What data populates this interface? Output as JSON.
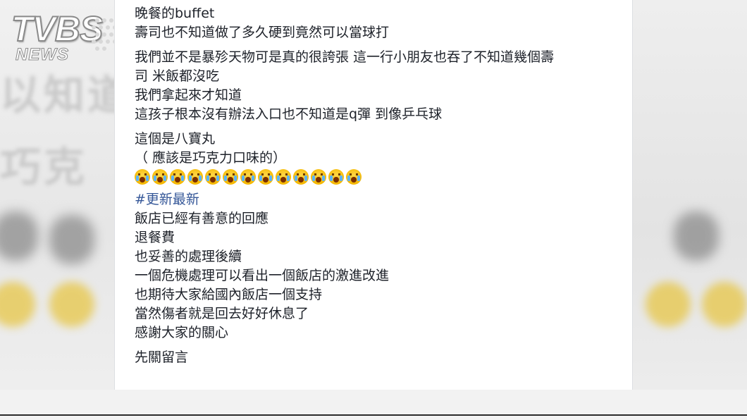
{
  "logo": {
    "main": "TVBS",
    "sub": "NEWS"
  },
  "post": {
    "paragraphs": [
      {
        "lines": [
          "晚餐的buffet",
          "壽司也不知道做了多久硬到竟然可以當球打"
        ]
      },
      {
        "lines": [
          "我們並不是暴殄天物可是真的很誇張 這一行小朋友也吞了不知道幾個壽",
          "司 米飯都沒吃",
          "我們拿起來才知道",
          "這孩子根本沒有辦法入口也不知道是q彈 到像乒乓球"
        ]
      },
      {
        "lines": [
          "這個是八寶丸",
          "（ 應該是巧克力口味的）"
        ]
      }
    ],
    "emoji": {
      "name": "crying-face-emoji",
      "count": 13
    },
    "hashtag": "#更新最新",
    "update_lines": [
      "飯店已經有善意的回應",
      "退餐費",
      "也妥善的處理後續",
      "一個危機處理可以看出一個飯店的激進改進",
      "也期待大家給國內飯店一個支持",
      "當然傷者就是回去好好休息了",
      "感謝大家的關心"
    ],
    "closing": "先關留言"
  },
  "background_blur_text": [
    "以知道",
    "巧克"
  ]
}
